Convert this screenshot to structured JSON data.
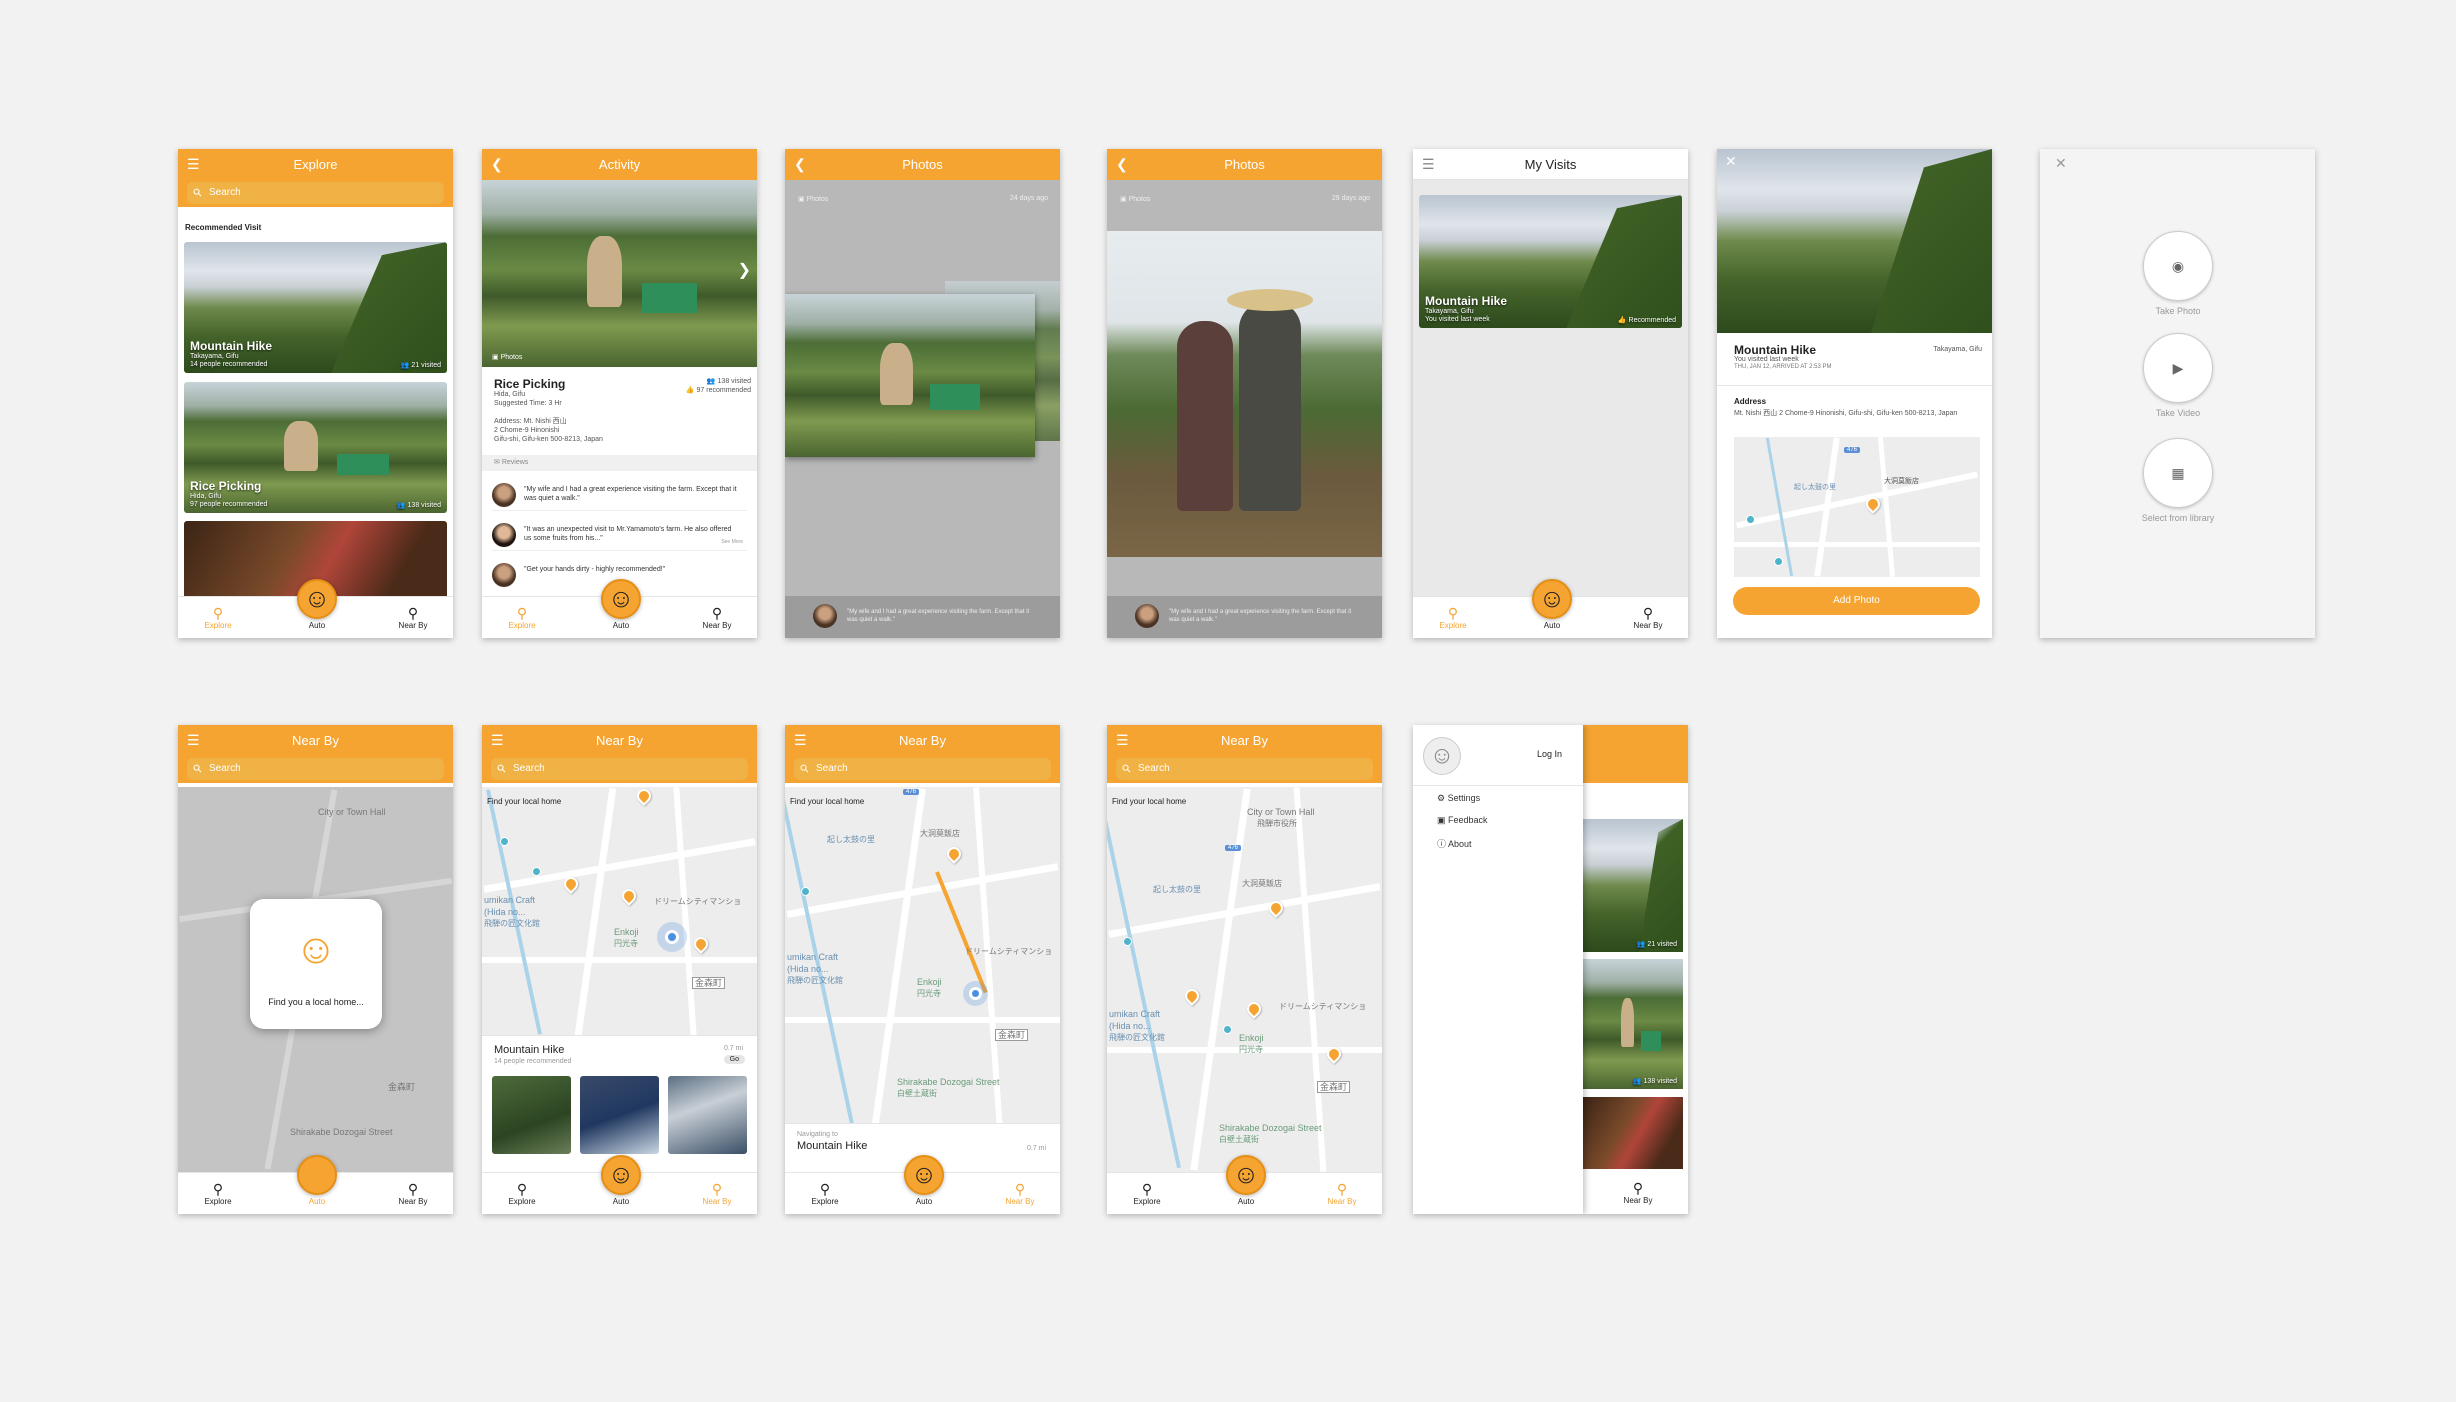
{
  "common": {
    "search_placeholder": "Search",
    "nav_explore": "Explore",
    "nav_auto": "Auto",
    "nav_nearby": "Near By",
    "find_local_home": "Find your local home",
    "review_1": "\"My wife and I had a great experience visiting the farm. Except that it was quiet a walk.\""
  },
  "explore": {
    "title": "Explore",
    "section": "Recommended Visit",
    "cards": [
      {
        "name": "Mountain Hike",
        "location": "Takayama, Gifu",
        "recommended": "14 people recommended",
        "visited": "21 visited"
      },
      {
        "name": "Rice Picking",
        "location": "Hida, Gifu",
        "recommended": "97 people recommended",
        "visited": "138 visited"
      }
    ]
  },
  "activity": {
    "title": "Activity",
    "photos_tag": "Photos",
    "name": "Rice Picking",
    "location": "Hida, Gifu",
    "suggested": "Suggested Time: 3 Hr",
    "visited": "138 visited",
    "recommended": "97 recommended",
    "address_1": "Address: Mt. Nishi 西山",
    "address_2": "2 Chome-9 Hinonishi",
    "address_3": "Gifu-shi, Gifu-ken 500-8213, Japan",
    "reviews_label": "Reviews",
    "review_2": "\"It was an unexpected visit to Mr.Yamamoto's farm. He also offered us some fruits from his...\"",
    "see_more": "See More",
    "review_3": "\"Get your hands dirty - highly recommended!\""
  },
  "photos": {
    "title": "Photos",
    "tag": "Photos",
    "time": "24 days ago",
    "time_2": "29 days ago"
  },
  "visits": {
    "title": "My Visits",
    "name": "Mountain Hike",
    "location": "Takayama, Gifu",
    "visited": "You visited last week",
    "badge": "Recommended"
  },
  "detail": {
    "name": "Mountain Hike",
    "region": "Takayama, Gifu",
    "visited": "You visited last week",
    "date": "THU, JAN 12, ARRIVED AT 2:53 PM",
    "address_label": "Address",
    "address": "Mt. Nishi 西山 2 Chome-9 Hinonishi, Gifu-shi, Gifu-ken 500-8213, Japan",
    "add_photo": "Add Photo"
  },
  "camera": {
    "take_photo": "Take Photo",
    "take_video": "Take Video",
    "library": "Select from library"
  },
  "nearby": {
    "title": "Near By",
    "dialog": "Find you a local home...",
    "place_name": "Mountain Hike",
    "place_rec": "14 people recommended",
    "distance": "0.7 mi",
    "go": "Go",
    "navigating": "Navigating to",
    "dest": "Mountain Hike",
    "dest_distance": "0.7 mi"
  },
  "map_labels": {
    "city_hall": "City or Town Hall",
    "city_hall_jp": "飛騨市役所",
    "craft_1": "umikan Craft",
    "craft_2": "(Hida no...",
    "craft_3": "飛騨の匠文化館",
    "enkoji": "Enkoji",
    "enkoji_jp": "円光寺",
    "mansion": "ドリームシティマンショ",
    "kanamori": "金森町",
    "street": "Shirakabe Dozogai Street",
    "street_jp": "白壁土蔵街",
    "okoshi": "起し太鼓の里",
    "hotel": "大洞莫飯店",
    "route": "476"
  },
  "drawer": {
    "login": "Log In",
    "settings": "Settings",
    "feedback": "Feedback",
    "about": "About",
    "visited_1": "21 visited",
    "visited_2": "138 visited"
  },
  "colors": {
    "accent": "#f5a431",
    "accent_dark": "#e58f14"
  }
}
